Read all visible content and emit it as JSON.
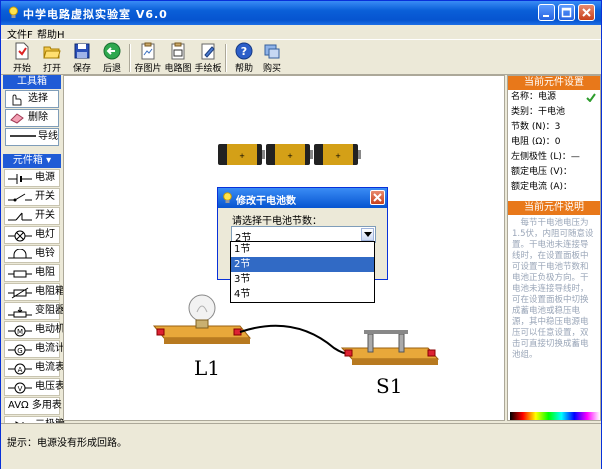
{
  "window": {
    "title": "中学电路虚拟实验室 V6.0"
  },
  "menu": {
    "items": [
      "文件F",
      "帮助H"
    ]
  },
  "toolbar": {
    "buttons": [
      {
        "label": "开始",
        "icon": "new-doc-icon"
      },
      {
        "label": "打开",
        "icon": "open-folder-icon"
      },
      {
        "label": "保存",
        "icon": "save-disk-icon"
      },
      {
        "label": "后退",
        "icon": "back-arrow-icon"
      },
      {
        "label": "存图片",
        "icon": "save-image-icon"
      },
      {
        "label": "电路图",
        "icon": "circuit-diagram-icon"
      },
      {
        "label": "手绘板",
        "icon": "sketch-board-icon"
      },
      {
        "label": "帮助",
        "icon": "help-icon"
      },
      {
        "label": "购买",
        "icon": "purchase-icon"
      }
    ]
  },
  "toolbox": {
    "title": "工具箱",
    "items": [
      {
        "label": "选择",
        "icon": "hand-pointer-icon"
      },
      {
        "label": "删除",
        "icon": "eraser-icon"
      },
      {
        "label": "导线",
        "icon": "wire-icon"
      }
    ]
  },
  "components": {
    "title": "元件箱",
    "items": [
      {
        "label": "电源",
        "icon": "power-source-icon"
      },
      {
        "label": "开关",
        "icon": "switch-icon"
      },
      {
        "label": "开关",
        "icon": "switch-alt-icon"
      },
      {
        "label": "电灯",
        "icon": "lamp-icon"
      },
      {
        "label": "电铃",
        "icon": "bell-icon"
      },
      {
        "label": "电阻",
        "icon": "resistor-icon"
      },
      {
        "label": "电阻箱",
        "icon": "resistor-box-icon"
      },
      {
        "label": "变阻器",
        "icon": "rheostat-icon"
      },
      {
        "label": "电动机",
        "icon": "motor-icon"
      },
      {
        "label": "电流计",
        "icon": "galvanometer-icon"
      },
      {
        "label": "电流表",
        "icon": "ammeter-icon"
      },
      {
        "label": "电压表",
        "icon": "voltmeter-icon"
      },
      {
        "label": "多用表",
        "icon": "multimeter-icon",
        "prefix": "AVΩ"
      },
      {
        "label": "二极管",
        "icon": "diode-icon"
      }
    ]
  },
  "properties": {
    "title": "当前元件设置",
    "lines": [
      {
        "key": "名称",
        "value": "电源"
      },
      {
        "key": "类别",
        "value": "干电池"
      },
      {
        "key": "节数 (N)",
        "value": "3"
      },
      {
        "key": "电阻 (Ω)",
        "value": "0"
      },
      {
        "key": "左侧极性 (L)",
        "value": "—"
      },
      {
        "key": "额定电压 (V)",
        "value": ""
      },
      {
        "key": "额定电流 (A)",
        "value": ""
      }
    ]
  },
  "description": {
    "title": "当前元件说明",
    "text": "每节干电池电压为1.5伏，内阻可随意设置。干电池未连接导线时，在设置面板中可设置干电池节数和电池正负极方向。干电池未连接导线时，可在设置面板中切换成蓄电池或稳压电源，其中稳压电源电压可以任意设置，双击可直接切换成蓄电池组。"
  },
  "status": {
    "text": "提示：电源没有形成回路。"
  },
  "dialog": {
    "title": "修改干电池数",
    "prompt": "请选择干电池节数：",
    "selected": "2节",
    "options": [
      "1节",
      "2节",
      "3节",
      "4节"
    ],
    "highlighted_index": 1
  },
  "canvas": {
    "labels": {
      "lamp": "L1",
      "switch": "S1"
    }
  },
  "colors": {
    "title_blue": "#0654d0",
    "accent_orange": "#e88a2e",
    "selection_blue": "#316ac5",
    "check_green": "#2e9d2e"
  }
}
